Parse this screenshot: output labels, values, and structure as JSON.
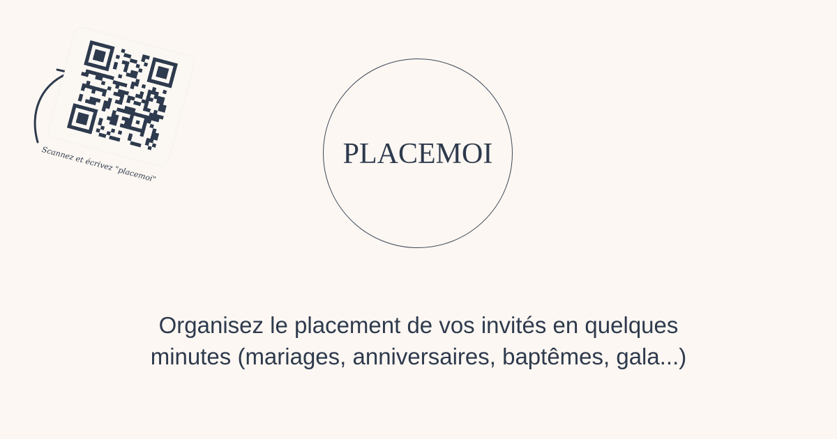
{
  "brand": {
    "name": "PLACEMOI"
  },
  "qr": {
    "caption": "Scannez et écrivez \"placemoi\""
  },
  "tagline": {
    "line1": "Organisez le placement de vos invités en quelques",
    "line2": "minutes (mariages, anniversaires, baptêmes, gala...)"
  },
  "colors": {
    "background": "#fcf7f2",
    "ink": "#2e3a4d"
  },
  "icons": {
    "arrow": "curved-arrow-icon",
    "qr": "qr-code-icon"
  }
}
